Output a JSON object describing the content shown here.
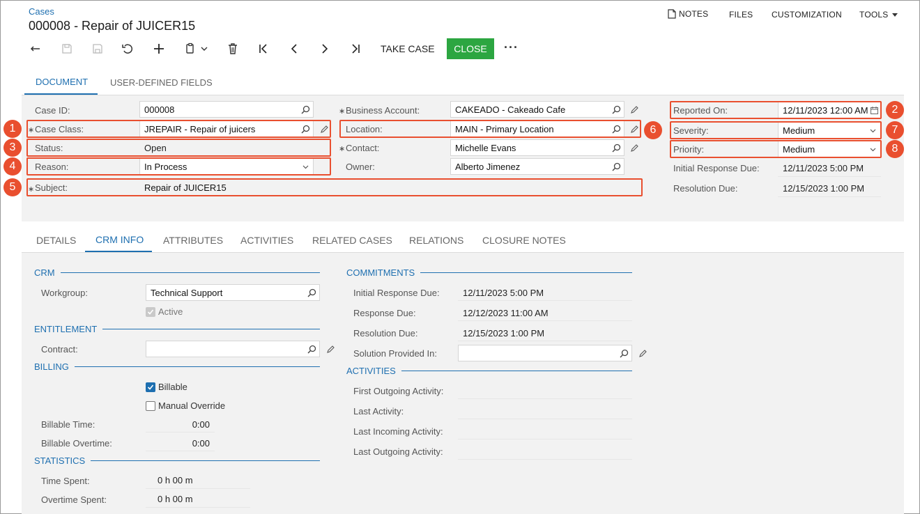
{
  "header": {
    "breadcrumb": "Cases",
    "title": "000008 - Repair of JUICER15",
    "nav": {
      "notes": "NOTES",
      "files": "FILES",
      "customization": "CUSTOMIZATION",
      "tools": "TOOLS"
    }
  },
  "toolbar": {
    "take_case": "TAKE CASE",
    "close": "CLOSE",
    "more": "···"
  },
  "doc_tabs": {
    "document": "DOCUMENT",
    "user_defined": "USER-DEFINED FIELDS"
  },
  "summary": {
    "case_id": {
      "label": "Case ID:",
      "value": "000008"
    },
    "case_class": {
      "label": "Case Class:",
      "value": "JREPAIR - Repair of juicers"
    },
    "status": {
      "label": "Status:",
      "value": "Open"
    },
    "reason": {
      "label": "Reason:",
      "value": "In Process"
    },
    "subject": {
      "label": "Subject:",
      "value": "Repair of JUICER15"
    },
    "business_account": {
      "label": "Business Account:",
      "value": "CAKEADO - Cakeado Cafe"
    },
    "location": {
      "label": "Location:",
      "value": "MAIN - Primary Location"
    },
    "contact": {
      "label": "Contact:",
      "value": "Michelle Evans"
    },
    "owner": {
      "label": "Owner:",
      "value": "Alberto Jimenez"
    },
    "reported_on": {
      "label": "Reported On:",
      "value": "12/11/2023 12:00 AM"
    },
    "severity": {
      "label": "Severity:",
      "value": "Medium"
    },
    "priority": {
      "label": "Priority:",
      "value": "Medium"
    },
    "initial_response_due": {
      "label": "Initial Response Due:",
      "value": "12/11/2023 5:00 PM"
    },
    "resolution_due": {
      "label": "Resolution Due:",
      "value": "12/15/2023 1:00 PM"
    }
  },
  "callouts": [
    "1",
    "2",
    "3",
    "4",
    "5",
    "6",
    "7",
    "8"
  ],
  "detail_tabs": {
    "details": "DETAILS",
    "crm_info": "CRM INFO",
    "attributes": "ATTRIBUTES",
    "activities": "ACTIVITIES",
    "related_cases": "RELATED CASES",
    "relations": "RELATIONS",
    "closure_notes": "CLOSURE NOTES"
  },
  "crm": {
    "title": "CRM",
    "workgroup": {
      "label": "Workgroup:",
      "value": "Technical Support"
    },
    "active": {
      "label": "Active",
      "checked": true,
      "disabled": true
    }
  },
  "entitlement": {
    "title": "ENTITLEMENT",
    "contract": {
      "label": "Contract:",
      "value": ""
    }
  },
  "billing": {
    "title": "BILLING",
    "billable": {
      "label": "Billable",
      "checked": true
    },
    "manual_override": {
      "label": "Manual Override",
      "checked": false
    },
    "billable_time": {
      "label": "Billable Time:",
      "value": "0:00"
    },
    "billable_overtime": {
      "label": "Billable Overtime:",
      "value": "0:00"
    }
  },
  "statistics": {
    "title": "STATISTICS",
    "time_spent": {
      "label": "Time Spent:",
      "value": "0 h 00 m"
    },
    "overtime_spent": {
      "label": "Overtime Spent:",
      "value": "0 h 00 m"
    }
  },
  "commitments": {
    "title": "COMMITMENTS",
    "initial_response_due": {
      "label": "Initial Response Due:",
      "value": "12/11/2023 5:00 PM"
    },
    "response_due": {
      "label": "Response Due:",
      "value": "12/12/2023 11:00 AM"
    },
    "resolution_due": {
      "label": "Resolution Due:",
      "value": "12/15/2023 1:00 PM"
    },
    "solution_provided_in": {
      "label": "Solution Provided In:",
      "value": ""
    }
  },
  "activities": {
    "title": "ACTIVITIES",
    "first_outgoing": {
      "label": "First Outgoing Activity:",
      "value": ""
    },
    "last_activity": {
      "label": "Last Activity:",
      "value": ""
    },
    "last_incoming": {
      "label": "Last Incoming Activity:",
      "value": ""
    },
    "last_outgoing": {
      "label": "Last Outgoing Activity:",
      "value": ""
    }
  },
  "colors": {
    "accent": "#1e6fb0",
    "close_button": "#2ca641",
    "callout": "#e94f2f"
  }
}
